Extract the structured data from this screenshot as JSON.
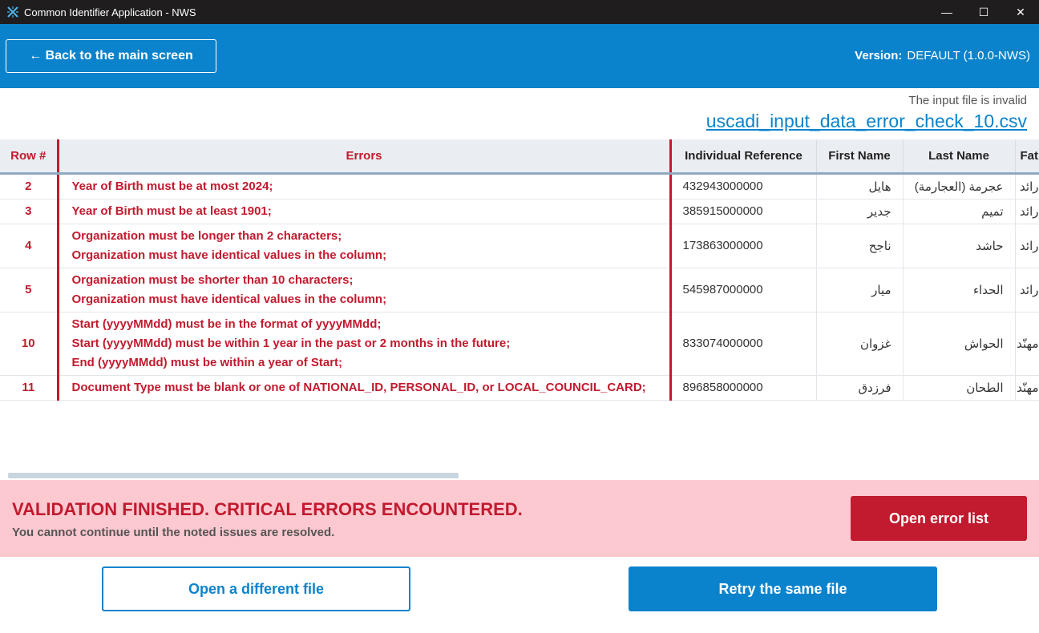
{
  "window": {
    "title": "Common Identifier Application - NWS",
    "controls": {
      "minimize": "—",
      "maximize": "☐",
      "close": "✕"
    }
  },
  "header": {
    "back_label": "← Back to the main screen",
    "version_label": "Version:",
    "version_value": "DEFAULT (1.0.0-NWS)"
  },
  "file": {
    "status": "The input file is invalid",
    "name": "uscadi_input_data_error_check_10.csv"
  },
  "table": {
    "columns": [
      "Row #",
      "Errors",
      "Individual Reference",
      "First Name",
      "Last Name",
      "Fat"
    ],
    "rows": [
      {
        "row": "2",
        "errors": [
          "Year of Birth must be at most 2024;"
        ],
        "ref": "432943000000",
        "first": "هايل",
        "last": "عجرمة (العجارمة)",
        "extra": "رائد"
      },
      {
        "row": "3",
        "errors": [
          "Year of Birth must be at least 1901;"
        ],
        "ref": "385915000000",
        "first": "جدير",
        "last": "تميم",
        "extra": "رائد"
      },
      {
        "row": "4",
        "errors": [
          "Organization must be longer than 2 characters;",
          "Organization must have identical values in the column;"
        ],
        "ref": "173863000000",
        "first": "ناجح",
        "last": "حاشد",
        "extra": "رائد"
      },
      {
        "row": "5",
        "errors": [
          "Organization must be shorter than 10 characters;",
          "Organization must have identical values in the column;"
        ],
        "ref": "545987000000",
        "first": "ميار",
        "last": "الحداء",
        "extra": "رائد"
      },
      {
        "row": "10",
        "errors": [
          "Start (yyyyMMdd) must be in the format of yyyyMMdd;",
          "Start (yyyyMMdd) must be within 1 year in the past or 2 months in the future;",
          "End (yyyyMMdd) must be within a year of Start;"
        ],
        "ref": "833074000000",
        "first": "غزوان",
        "last": "الحواش",
        "extra": "مهنّد"
      },
      {
        "row": "11",
        "errors": [
          "Document Type must be blank or one of NATIONAL_ID, PERSONAL_ID, or LOCAL_COUNCIL_CARD;"
        ],
        "ref": "896858000000",
        "first": "فرزدق",
        "last": "الطحان",
        "extra": "مهنّد"
      }
    ]
  },
  "banner": {
    "title": "VALIDATION FINISHED. CRITICAL ERRORS ENCOUNTERED.",
    "subtitle": "You cannot continue until the noted issues are resolved.",
    "open_errors_label": "Open error list"
  },
  "actions": {
    "open_different_label": "Open a different file",
    "retry_label": "Retry the same file"
  },
  "colors": {
    "accent": "#0b83cc",
    "error": "#c21a2e",
    "banner_bg": "#fdc9d1",
    "titlebar_bg": "#1f1d1e"
  }
}
